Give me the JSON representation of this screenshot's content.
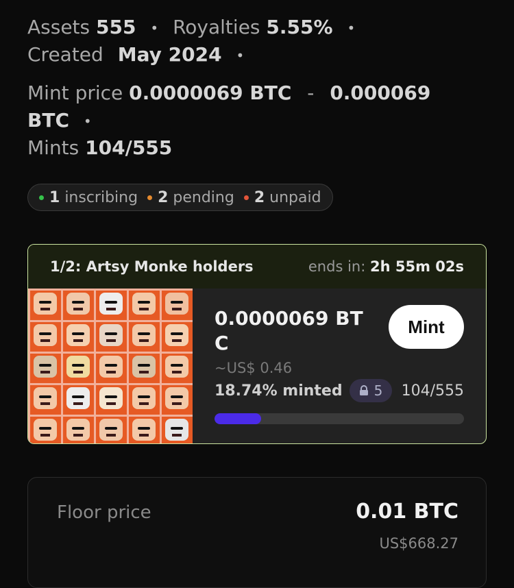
{
  "meta": {
    "assets_label": "Assets",
    "assets_value": "555",
    "royalties_label": "Royalties",
    "royalties_value": "5.55%",
    "created_label": "Created",
    "created_value": "May 2024",
    "mint_price_label": "Mint price",
    "mint_price_min": "0.0000069 BTC",
    "mint_price_dash": "-",
    "mint_price_max_a": "0.000069",
    "mint_price_max_b": "BTC",
    "mints_label": "Mints",
    "mints_value": "104/555",
    "separator": "•"
  },
  "status": {
    "inscribing_count": "1",
    "inscribing_label": "inscribing",
    "inscribing_color": "#35c24a",
    "pending_count": "2",
    "pending_label": "pending",
    "pending_color": "#e58a2e",
    "unpaid_count": "2",
    "unpaid_label": "unpaid",
    "unpaid_color": "#e2553a"
  },
  "phase": {
    "title": "1/2: Artsy Monke holders",
    "ends_label": "ends in:",
    "ends_value": "2h 55m 02s",
    "price": "0.0000069 BTC",
    "usd": "~US$ 0.46",
    "minted_pct_label": "18.74% minted",
    "minted_fraction": 0.1874,
    "lock_count": "5",
    "count": "104/555",
    "mint_button": "Mint",
    "accent": "#4b2be8",
    "border": "#cde6a2"
  },
  "floor": {
    "label": "Floor price",
    "value": "0.01 BTC",
    "usd": "US$668.27"
  },
  "icons": {
    "lock": "lock-icon",
    "art": "collection-thumbnail"
  }
}
